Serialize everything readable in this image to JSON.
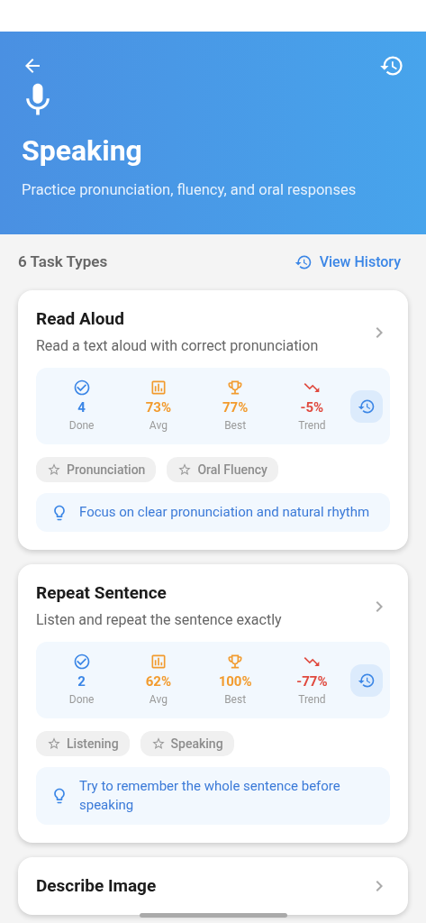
{
  "header": {
    "title": "Speaking",
    "subtitle": "Practice pronunciation, fluency, and oral responses"
  },
  "section": {
    "count_label": "6 Task Types",
    "history_link": "View History"
  },
  "tasks": [
    {
      "title": "Read Aloud",
      "description": "Read a text aloud with correct pronunciation",
      "stats": [
        {
          "kind": "done",
          "value": "4",
          "label": "Done"
        },
        {
          "kind": "avg",
          "value": "73%",
          "label": "Avg"
        },
        {
          "kind": "best",
          "value": "77%",
          "label": "Best"
        },
        {
          "kind": "trend",
          "value": "-5%",
          "label": "Trend"
        }
      ],
      "tags": [
        "Pronunciation",
        "Oral Fluency"
      ],
      "tip": "Focus on clear pronunciation and natural rhythm"
    },
    {
      "title": "Repeat Sentence",
      "description": "Listen and repeat the sentence exactly",
      "stats": [
        {
          "kind": "done",
          "value": "2",
          "label": "Done"
        },
        {
          "kind": "avg",
          "value": "62%",
          "label": "Avg"
        },
        {
          "kind": "best",
          "value": "100%",
          "label": "Best"
        },
        {
          "kind": "trend",
          "value": "-77%",
          "label": "Trend"
        }
      ],
      "tags": [
        "Listening",
        "Speaking"
      ],
      "tip": "Try to remember the whole sentence before speaking"
    },
    {
      "title": "Describe Image"
    }
  ]
}
